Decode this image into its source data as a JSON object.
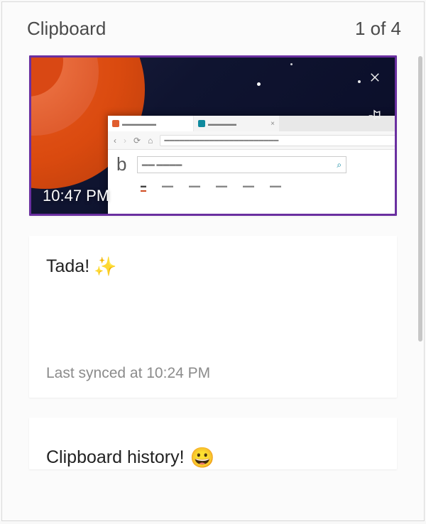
{
  "header": {
    "title": "Clipboard",
    "counter": "1 of 4"
  },
  "items": [
    {
      "type": "image",
      "timestamp": "10:47 PM",
      "selected": true
    },
    {
      "type": "text",
      "content": "Tada!",
      "emoji": "✨",
      "syncStatus": "Last synced at 10:24 PM"
    },
    {
      "type": "text",
      "content": "Clipboard history!",
      "emoji": "😀"
    }
  ],
  "icons": {
    "close": "close-icon",
    "pin": "pin-icon"
  }
}
